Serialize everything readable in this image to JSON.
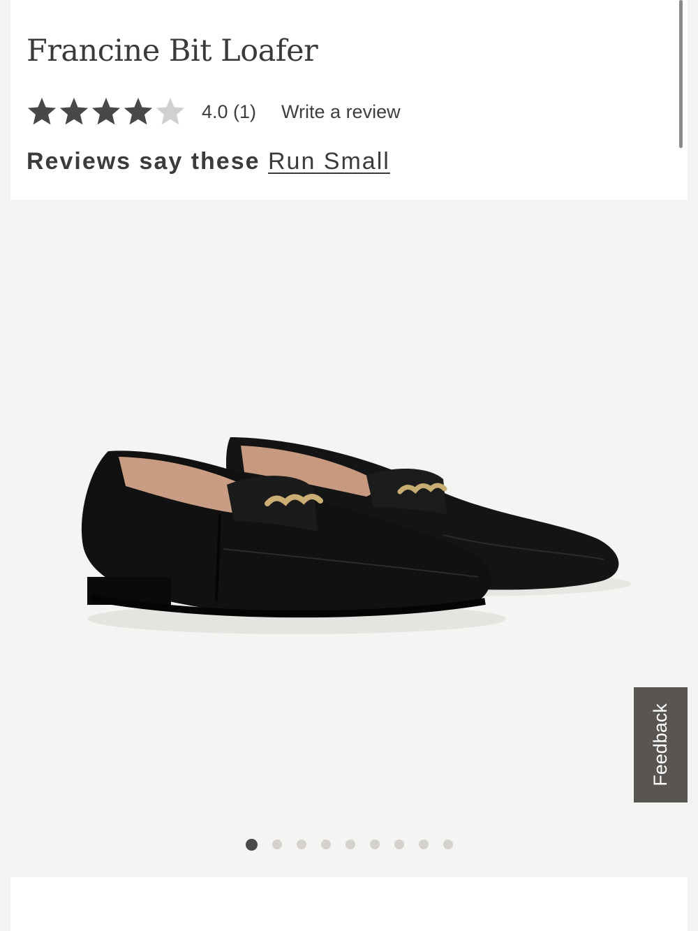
{
  "product": {
    "title": "Francine Bit Loafer"
  },
  "rating": {
    "value": 4.0,
    "max": 5,
    "display": "4.0 (1)",
    "write_review_label": "Write a review",
    "star_filled_color": "#4a4847",
    "star_empty_color": "#d0d0d0"
  },
  "fit": {
    "prefix": "Reviews say these",
    "link_label": "Run Small"
  },
  "gallery": {
    "image_icon": "loafer-product-photo",
    "total_images": 9,
    "active_index": 0
  },
  "feedback": {
    "label": "Feedback"
  }
}
